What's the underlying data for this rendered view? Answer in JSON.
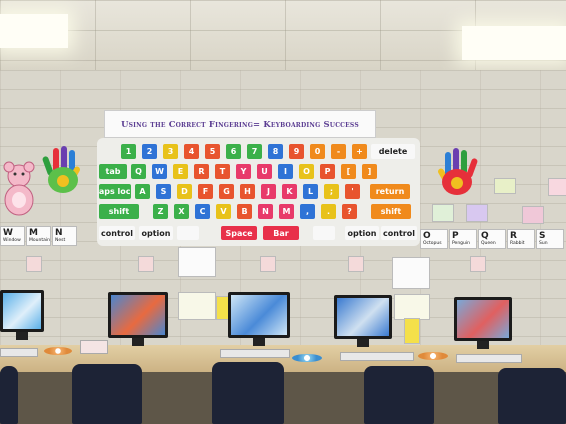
{
  "banner": {
    "text": "Using the Correct Fingering= Keyboarding Success"
  },
  "keyboard": {
    "rows": [
      {
        "keys": [
          "1",
          "2",
          "3",
          "4",
          "5",
          "6",
          "7",
          "8",
          "9",
          "0",
          "-",
          "+",
          "delete"
        ]
      },
      {
        "keys": [
          "tab",
          "Q",
          "W",
          "E",
          "R",
          "T",
          "Y",
          "U",
          "I",
          "O",
          "P",
          "[",
          "]"
        ]
      },
      {
        "keys": [
          "caps lock",
          "A",
          "S",
          "D",
          "F",
          "G",
          "H",
          "J",
          "K",
          "L",
          ";",
          "'",
          "return"
        ]
      },
      {
        "keys": [
          "shift",
          "Z",
          "X",
          "C",
          "V",
          "B",
          "N",
          "M",
          ",",
          ".",
          "?",
          "shift"
        ]
      },
      {
        "keys": [
          "control",
          "option",
          "",
          "Space",
          "Bar",
          "",
          "option",
          "control"
        ]
      }
    ]
  },
  "side_cards": {
    "left": [
      "W",
      "M",
      "N"
    ],
    "left_words": [
      "Window",
      "Mountain",
      "Nest"
    ],
    "right": [
      "O",
      "P",
      "Q",
      "R",
      "S"
    ],
    "right_words": [
      "Octopus",
      "Penguin",
      "Queen",
      "Rabbit",
      "Sun"
    ]
  },
  "colors": {
    "wall": "#d9d6cb",
    "banner_text": "#5b3d92",
    "desk": "#d8c190",
    "chair": "#1d2336"
  }
}
